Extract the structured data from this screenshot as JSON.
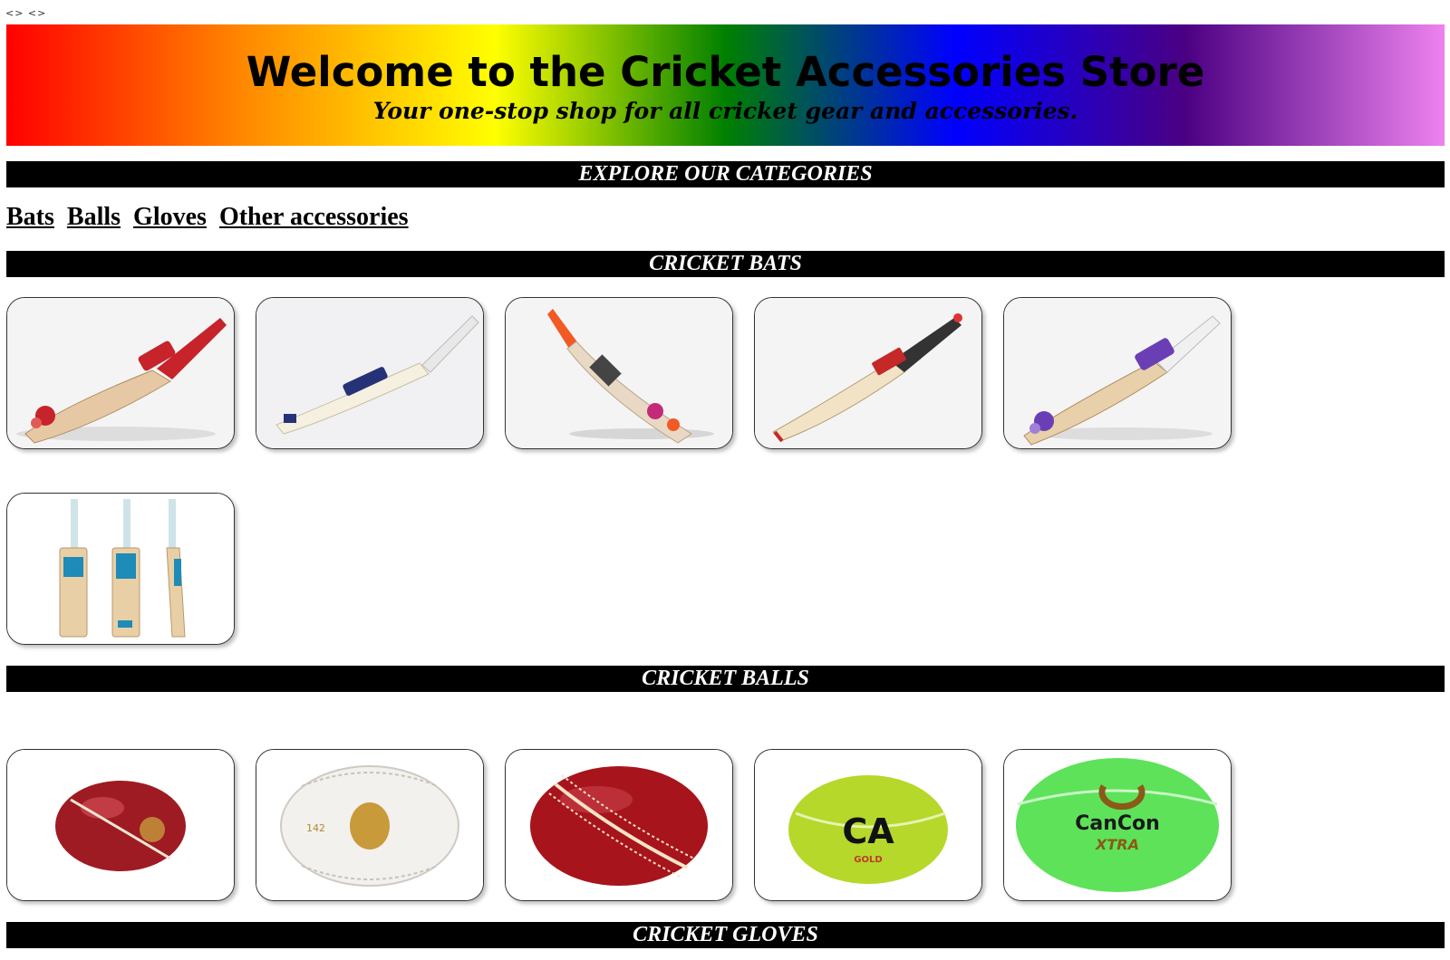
{
  "broken_images": "<> <>",
  "header": {
    "title": "Welcome to the Cricket Accessories Store",
    "tagline": "Your one-stop shop for all cricket gear and accessories."
  },
  "categories_heading": "EXPLORE OUR CATEGORIES",
  "nav": [
    "Bats",
    "Balls",
    "Gloves",
    "Other accessories"
  ],
  "sections": {
    "bats": {
      "heading": "CRICKET BATS",
      "products": [
        {
          "icon": "cricket-bat-ss-red"
        },
        {
          "icon": "cricket-bat-gm-white"
        },
        {
          "icon": "cricket-bat-sg-orange"
        },
        {
          "icon": "cricket-bat-nb-red"
        },
        {
          "icon": "cricket-bat-ss-purple"
        },
        {
          "icon": "cricket-bat-gm-three-view"
        }
      ]
    },
    "balls": {
      "heading": "CRICKET BALLS",
      "products": [
        {
          "icon": "red-leather-ball"
        },
        {
          "icon": "white-leather-ball"
        },
        {
          "icon": "red-leather-ball-seam"
        },
        {
          "icon": "yellow-tennis-ball"
        },
        {
          "icon": "green-tennis-ball"
        }
      ]
    },
    "gloves": {
      "heading": "CRICKET GLOVES"
    }
  },
  "brand_marks": {
    "gloss_gold": "GOLD",
    "cancon": "CanCon",
    "cancon_sub": "XTRA"
  },
  "colors": {
    "bar_bg": "#000000",
    "bar_text": "#ffffff",
    "card_border": "#333333"
  }
}
